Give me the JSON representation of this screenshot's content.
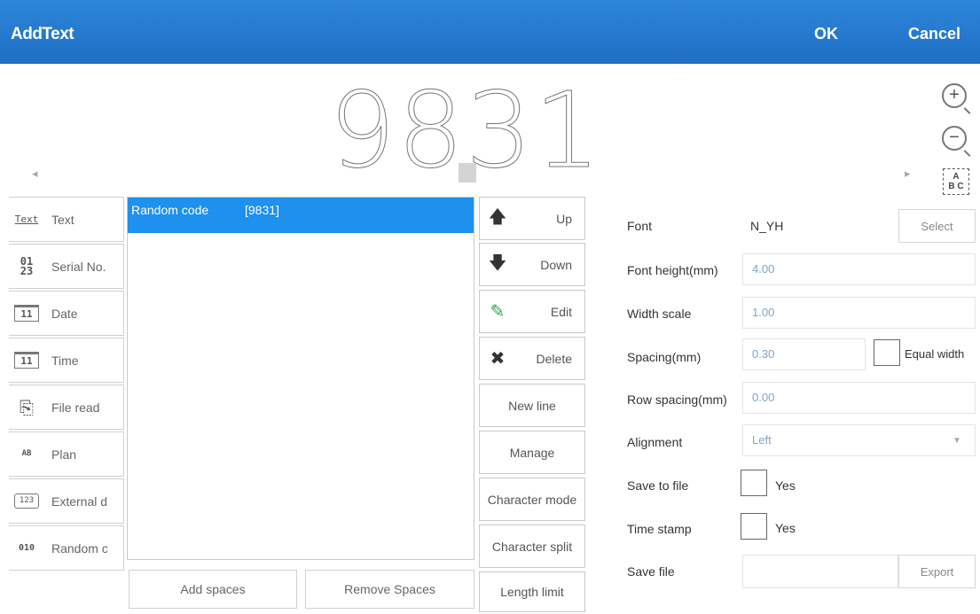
{
  "title_bar": {
    "title": "AddText",
    "ok_label": "OK",
    "cancel_label": "Cancel"
  },
  "preview": {
    "text": "9831",
    "zoom_in": "+",
    "zoom_out": "−",
    "abc_line1": "A",
    "abc_line2": "B C",
    "left_arrow": "◂",
    "right_arrow": "▸"
  },
  "types": [
    {
      "icon": "Text",
      "label": "Text"
    },
    {
      "icon": "01\n23",
      "label": "Serial No."
    },
    {
      "icon": "11",
      "label": "Date"
    },
    {
      "icon": "11",
      "label": "Time"
    },
    {
      "icon": "⎘",
      "label": "File read"
    },
    {
      "icon": "AB",
      "label": "Plan"
    },
    {
      "icon": "123",
      "label": "External d"
    },
    {
      "icon": "010",
      "label": "Random c"
    }
  ],
  "element_list": [
    {
      "name": "Random code",
      "value": "[9831]"
    }
  ],
  "bottom_buttons": {
    "add_spaces": "Add spaces",
    "remove_spaces": "Remove Spaces"
  },
  "actions": {
    "up": "Up",
    "down": "Down",
    "edit": "Edit",
    "delete": "Delete",
    "new_line": "New line",
    "manage": "Manage",
    "character_mode": "Character mode",
    "character_split": "Character split",
    "length_limit": "Length limit"
  },
  "properties": {
    "font_label": "Font",
    "font_value": "N_YH",
    "select_label": "Select",
    "font_height_label": "Font height(mm)",
    "font_height_value": "4.00",
    "width_scale_label": "Width scale",
    "width_scale_value": "1.00",
    "spacing_label": "Spacing(mm)",
    "spacing_value": "0.30",
    "equal_width_label": "Equal width",
    "row_spacing_label": "Row spacing(mm)",
    "row_spacing_value": "0.00",
    "alignment_label": "Alignment",
    "alignment_value": "Left",
    "save_to_file_label": "Save to file",
    "save_to_file_yes": "Yes",
    "time_stamp_label": "Time stamp",
    "time_stamp_yes": "Yes",
    "save_file_label": "Save file",
    "save_file_value": "",
    "export_label": "Export"
  },
  "colors": {
    "title_bar": "#1f6fc4",
    "selection": "#1e90ee",
    "field_text": "#7fa6c8"
  }
}
